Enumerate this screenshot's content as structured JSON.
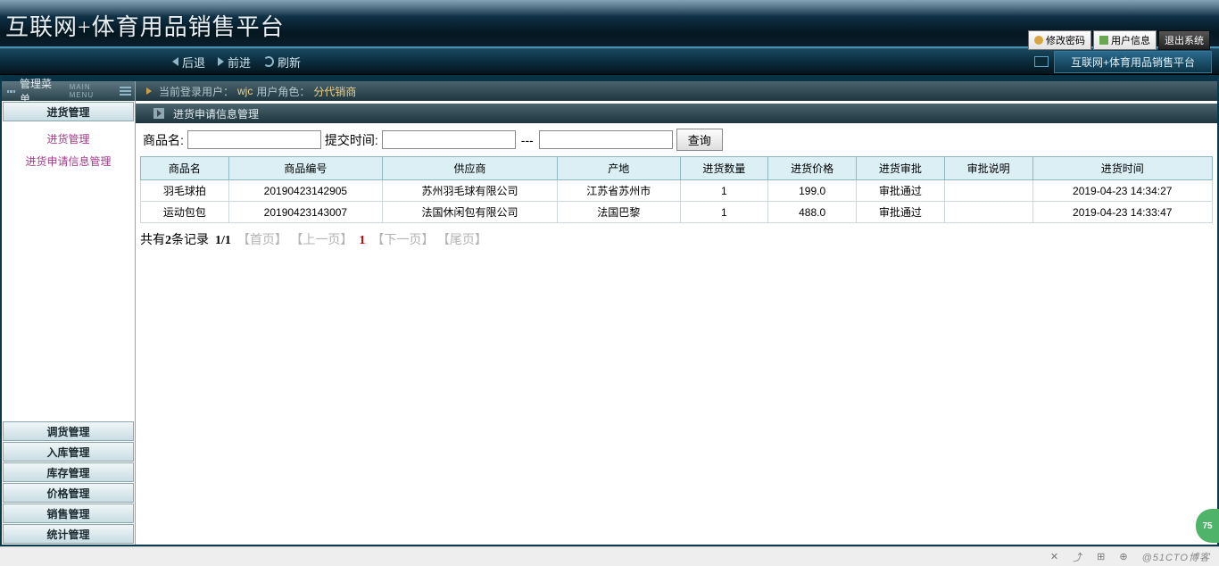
{
  "header": {
    "title": "互联网+体育用品销售平台",
    "change_pw": "修改密码",
    "user_info": "用户信息",
    "logout": "退出系统"
  },
  "nav": {
    "back": "后退",
    "forward": "前进",
    "refresh": "刷新",
    "breadcrumb": "互联网+体育用品销售平台"
  },
  "sidebar": {
    "title": "管理菜单",
    "subtitle": "MAIN MENU",
    "active_section": "进货管理",
    "links": [
      {
        "label": "进货管理"
      },
      {
        "label": "进货申请信息管理"
      }
    ],
    "sections": [
      {
        "label": "调货管理"
      },
      {
        "label": "入库管理"
      },
      {
        "label": "库存管理"
      },
      {
        "label": "价格管理"
      },
      {
        "label": "销售管理"
      },
      {
        "label": "统计管理"
      }
    ]
  },
  "loginbar": {
    "label_user": "当前登录用户：",
    "user": "wjc",
    "label_role": "用户角色：",
    "role": "分代销商"
  },
  "panel": {
    "title": "进货申请信息管理"
  },
  "search": {
    "name_label": "商品名:",
    "time_label": "提交时间:",
    "sep": "---",
    "query_btn": "查询"
  },
  "table": {
    "headers": [
      "商品名",
      "商品编号",
      "供应商",
      "产地",
      "进货数量",
      "进货价格",
      "进货审批",
      "审批说明",
      "进货时间"
    ],
    "rows": [
      [
        "羽毛球拍",
        "20190423142905",
        "苏州羽毛球有限公司",
        "江苏省苏州市",
        "1",
        "199.0",
        "审批通过",
        "",
        "2019-04-23 14:34:27"
      ],
      [
        "运动包包",
        "20190423143007",
        "法国休闲包有限公司",
        "法国巴黎",
        "1",
        "488.0",
        "审批通过",
        "",
        "2019-04-23 14:33:47"
      ]
    ]
  },
  "pager": {
    "summary_prefix": "共有",
    "count": "2",
    "summary_suffix": "条记录",
    "page": "1/1",
    "first": "【首页】",
    "prev": "【上一页】",
    "cur": "1",
    "next": "【下一页】",
    "last": "【尾页】"
  },
  "footer": {
    "watermark": "@51CTO博客"
  },
  "badge": {
    "val": "75"
  }
}
